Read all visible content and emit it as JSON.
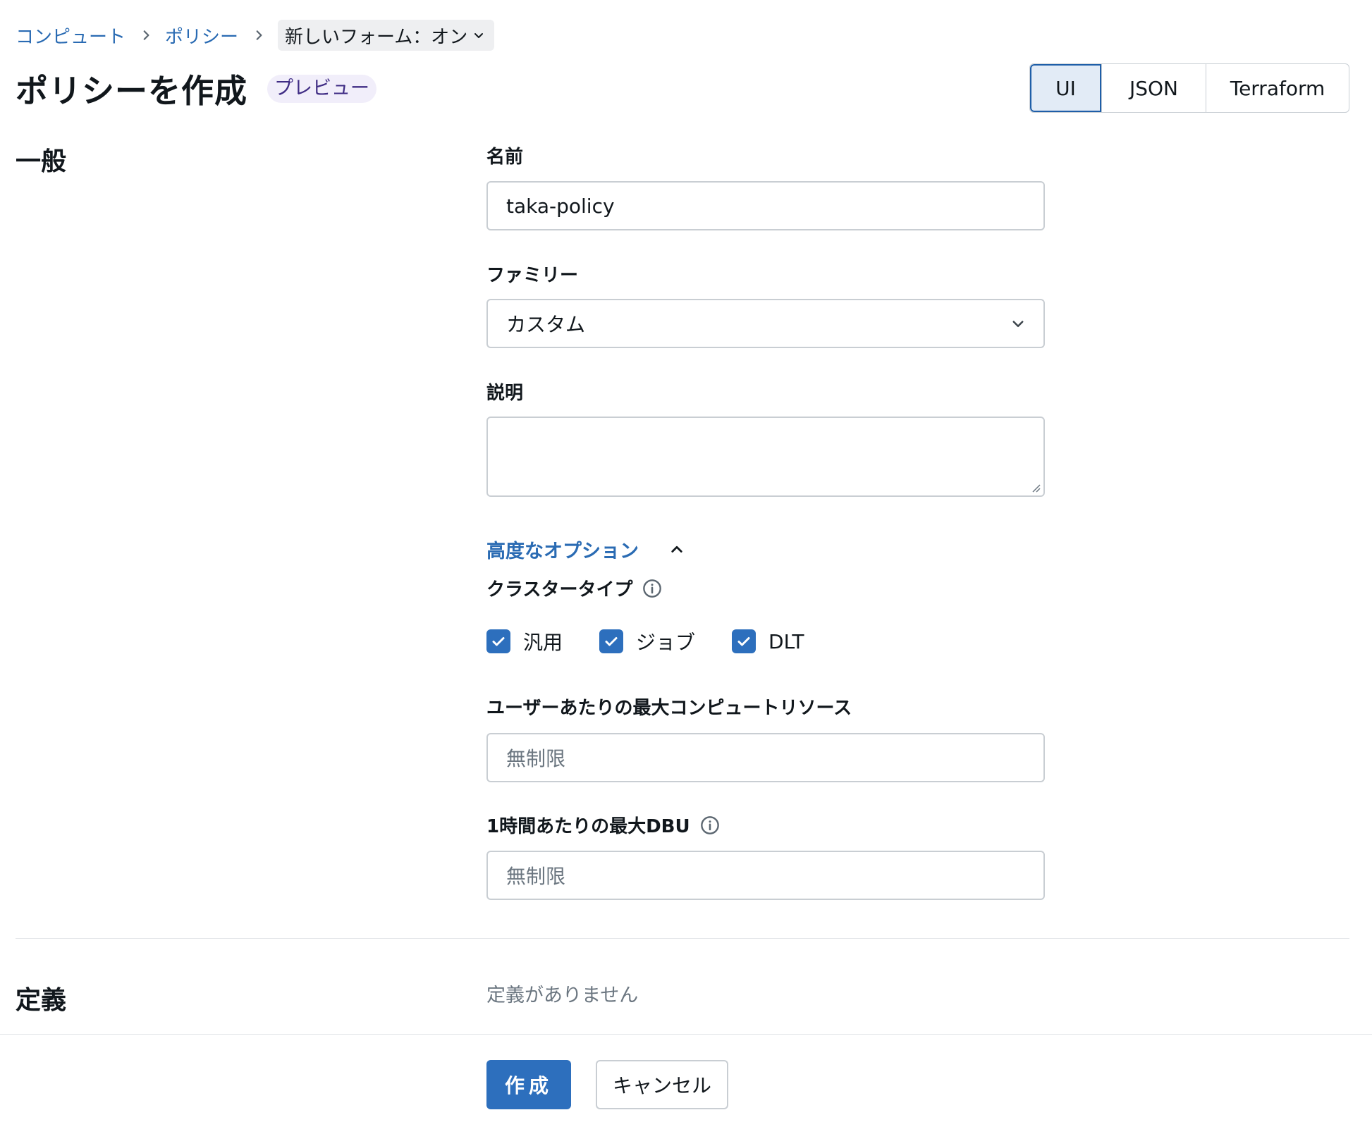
{
  "breadcrumb": {
    "items": [
      "コンピュート",
      "ポリシー"
    ],
    "current": "新しいフォーム：オン"
  },
  "header": {
    "title": "ポリシーを作成",
    "badge": "プレビュー",
    "view_modes": [
      "UI",
      "JSON",
      "Terraform"
    ],
    "selected_view": "UI"
  },
  "general": {
    "section_title": "一般",
    "name_label": "名前",
    "name_value": "taka-policy",
    "family_label": "ファミリー",
    "family_value": "カスタム",
    "description_label": "説明",
    "description_value": "",
    "advanced_label": "高度なオプション",
    "cluster_type_label": "クラスタータイプ",
    "cluster_types": [
      {
        "label": "汎用",
        "checked": true
      },
      {
        "label": "ジョブ",
        "checked": true
      },
      {
        "label": "DLT",
        "checked": true
      }
    ],
    "max_compute_label": "ユーザーあたりの最大コンピュートリソース",
    "max_compute_placeholder": "無制限",
    "max_dbu_label": "1時間あたりの最大DBU",
    "max_dbu_placeholder": "無制限"
  },
  "definitions": {
    "section_title": "定義",
    "empty_text": "定義がありません"
  },
  "footer": {
    "create_label": "作成",
    "cancel_label": "キャンセル"
  },
  "colors": {
    "primary": "#2d6fbd",
    "link": "#2a6bb3",
    "badge_bg": "#f1eefa"
  }
}
